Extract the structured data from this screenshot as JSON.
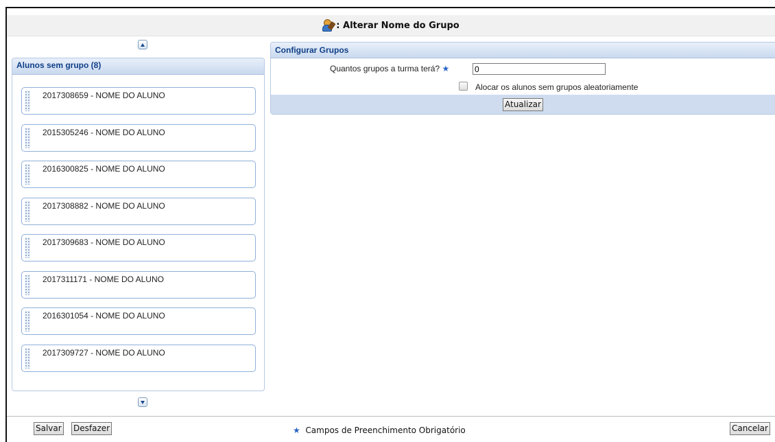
{
  "title": ": Alterar Nome do Grupo",
  "left_panel": {
    "header": "Alunos sem grupo (8)",
    "students": [
      "2017308659 - NOME DO ALUNO",
      "2015305246 - NOME DO ALUNO",
      "2016300825 - NOME DO ALUNO",
      "2017308882 - NOME DO ALUNO",
      "2017309683 - NOME DO ALUNO",
      "2017311171 - NOME DO ALUNO",
      "2016301054 - NOME DO ALUNO",
      "2017309727 - NOME DO ALUNO"
    ]
  },
  "config": {
    "header": "Configurar Grupos",
    "groups_label": "Quantos grupos a turma terá?",
    "groups_value": "0",
    "random_label": "Alocar os alunos sem grupos aleatoriamente",
    "random_checked": false,
    "update_button": "Atualizar"
  },
  "footer": {
    "save_button": "Salvar",
    "undo_button": "Desfazer",
    "required_note": "Campos de Preenchimento Obrigatório",
    "cancel_button": "Cancelar"
  },
  "icons": {
    "title": "group-edit-icon",
    "scroll_up": "arrow-up-icon",
    "scroll_down": "arrow-down-icon",
    "required": "asterisk-icon"
  },
  "colors": {
    "panel_header_text": "#0f3f86",
    "panel_border": "#b5c9e2",
    "action_bar": "#cfdcf0",
    "required_star": "#2a64c5"
  }
}
